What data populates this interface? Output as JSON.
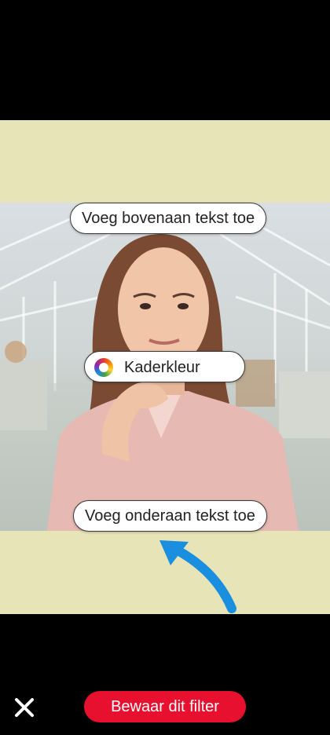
{
  "editor": {
    "add_top_text": "Voeg bovenaan tekst toe",
    "frame_color": "Kaderkleur",
    "add_bottom_text": "Voeg onderaan tekst toe"
  },
  "footer": {
    "save_filter": "Bewaar dit filter"
  },
  "icons": {
    "close": "close-icon",
    "color": "color-wheel-icon",
    "hint": "curved-arrow-icon"
  },
  "colors": {
    "frame": "#e7e4b8",
    "accent": "#e8102f",
    "hint_arrow": "#1a8fe0",
    "background": "#000000"
  }
}
